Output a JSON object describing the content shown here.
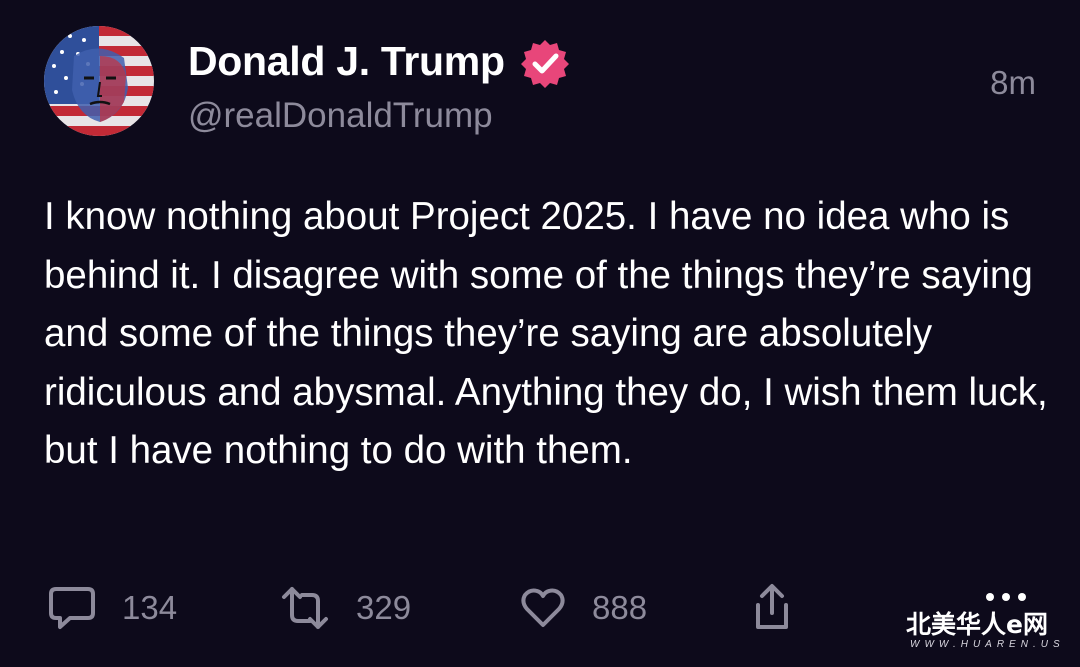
{
  "post": {
    "display_name": "Donald J. Trump",
    "handle": "@realDonaldTrump",
    "timestamp": "8m",
    "verified": true,
    "text": "I know nothing about Project 2025. I have no idea who is behind it. I disagree with some of the things they’re saying and some of the things they’re saying are absolutely ridiculous and abysmal. Anything they do, I wish them luck, but I have nothing to do with them."
  },
  "actions": {
    "reply_count": "134",
    "repost_count": "329",
    "like_count": "888"
  },
  "icons": {
    "reply": "comment-bubble-icon",
    "repost": "repost-arrows-icon",
    "like": "heart-icon",
    "share": "share-upload-icon",
    "verified": "verified-badge-icon"
  },
  "colors": {
    "background": "#0d0a1b",
    "text_primary": "#ffffff",
    "text_secondary": "#8d8a9b",
    "verified_badge": "#e8467a"
  },
  "watermark": {
    "brand": "北美华人e网",
    "url": "WWW.HUAREN.US"
  }
}
